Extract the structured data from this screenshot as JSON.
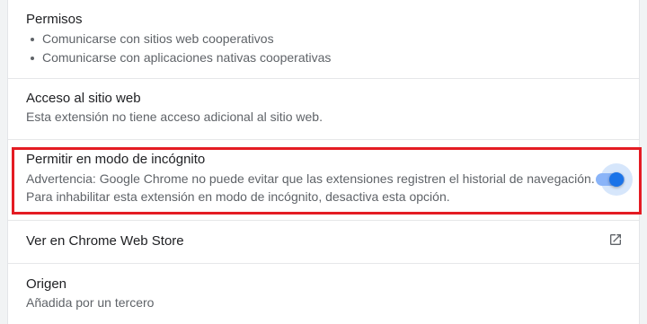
{
  "permissions": {
    "title": "Permisos",
    "items": [
      "Comunicarse con sitios web cooperativos",
      "Comunicarse con aplicaciones nativas cooperativas"
    ]
  },
  "site_access": {
    "title": "Acceso al sitio web",
    "description": "Esta extensión no tiene acceso adicional al sitio web."
  },
  "incognito": {
    "title": "Permitir en modo de incógnito",
    "warning": "Advertencia: Google Chrome no puede evitar que las extensiones registren el historial de navegación.",
    "instruction": "Para inhabilitar esta extensión en modo de incógnito, desactiva esta opción.",
    "toggle_on": true,
    "accent_color": "#1a73e8",
    "highlight_color": "#e41c23"
  },
  "web_store": {
    "label": "Ver en Chrome Web Store",
    "icon": "open-in-new-icon"
  },
  "origin": {
    "title": "Origen",
    "description": "Añadida por un tercero"
  }
}
